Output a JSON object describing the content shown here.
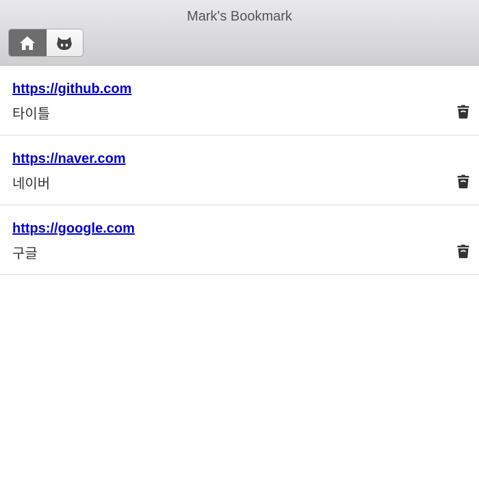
{
  "header": {
    "title": "Mark's Bookmark",
    "tabs": [
      {
        "icon": "home-icon",
        "active": true
      },
      {
        "icon": "github-icon",
        "active": false
      }
    ]
  },
  "bookmarks": [
    {
      "url": "https://github.com",
      "title": "타이틀"
    },
    {
      "url": "https://naver.com",
      "title": "네이버"
    },
    {
      "url": "https://google.com",
      "title": "구글"
    }
  ],
  "colors": {
    "link": "#0000cc",
    "active_tab": "#6d6d6d"
  }
}
